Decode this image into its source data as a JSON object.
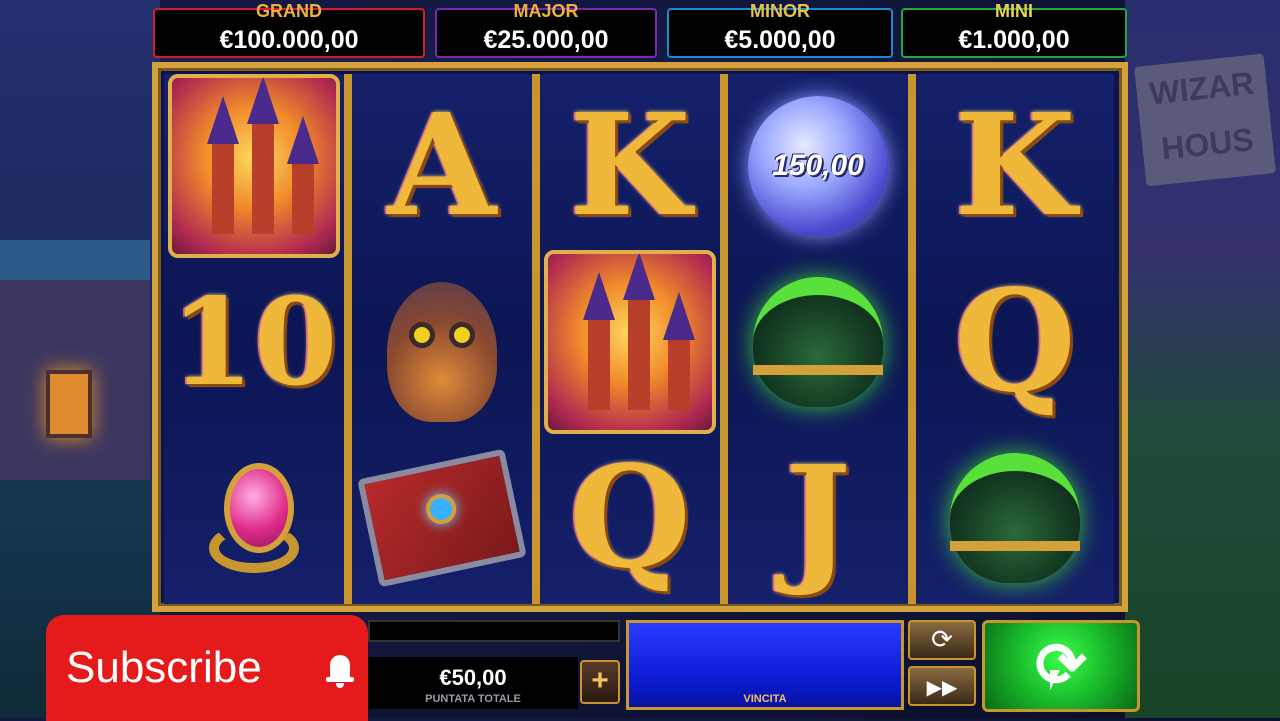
{
  "jackpots": {
    "grand": {
      "label": "GRAND",
      "value": "€100.000,00"
    },
    "major": {
      "label": "MAJOR",
      "value": "€25.000,00"
    },
    "minor": {
      "label": "MINOR",
      "value": "€5.000,00"
    },
    "mini": {
      "label": "MINI",
      "value": "€1.000,00"
    }
  },
  "reels": [
    [
      "castle-icon",
      "10",
      "ring-icon"
    ],
    [
      "A",
      "owl-icon",
      "spellbook-icon"
    ],
    [
      "K",
      "castle-icon",
      "Q"
    ],
    [
      "orb-icon",
      "cauldron-icon",
      "J"
    ],
    [
      "K",
      "Q",
      "cauldron-icon"
    ]
  ],
  "orb_value": "150,00",
  "scenery": {
    "sign_text_1": "WIZAR",
    "sign_text_2": "HOUS"
  },
  "bet": {
    "value": "€50,00",
    "caption": "PUNTATA TOTALE",
    "plus_label": "+"
  },
  "win": {
    "caption": "VINCITA"
  },
  "buttons": {
    "autoplay_icon": "⟳",
    "turbo_icon": "▶▶",
    "spin_icon": "⟳"
  },
  "overlay": {
    "subscribe_label": "Subscribe"
  },
  "colors": {
    "spin": "#18b82a",
    "win_panel": "#0a1ad0",
    "frame": "#d4a23c",
    "subscribe": "#e51b1b"
  }
}
